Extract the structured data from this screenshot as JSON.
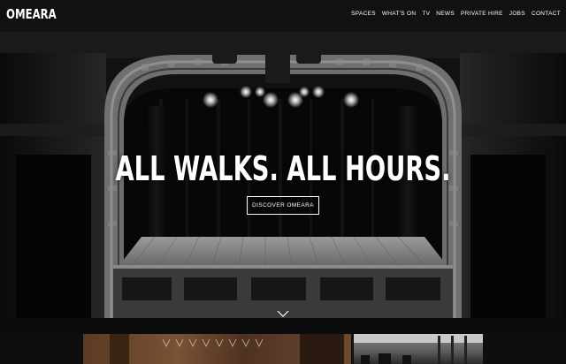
{
  "brand": {
    "logo": "OMEARA"
  },
  "nav": {
    "items": [
      "SPACES",
      "WHAT'S ON",
      "TV",
      "NEWS",
      "PRIVATE HIRE",
      "JOBS",
      "CONTACT"
    ]
  },
  "hero": {
    "headline": "ALL WALKS. ALL HOURS.",
    "cta_label": "DISCOVER OMEARA",
    "scroll_icon": "chevron-down-icon"
  },
  "colors": {
    "background": "#0b0b0b",
    "text": "#ffffff",
    "accent_border": "#ffffff"
  }
}
